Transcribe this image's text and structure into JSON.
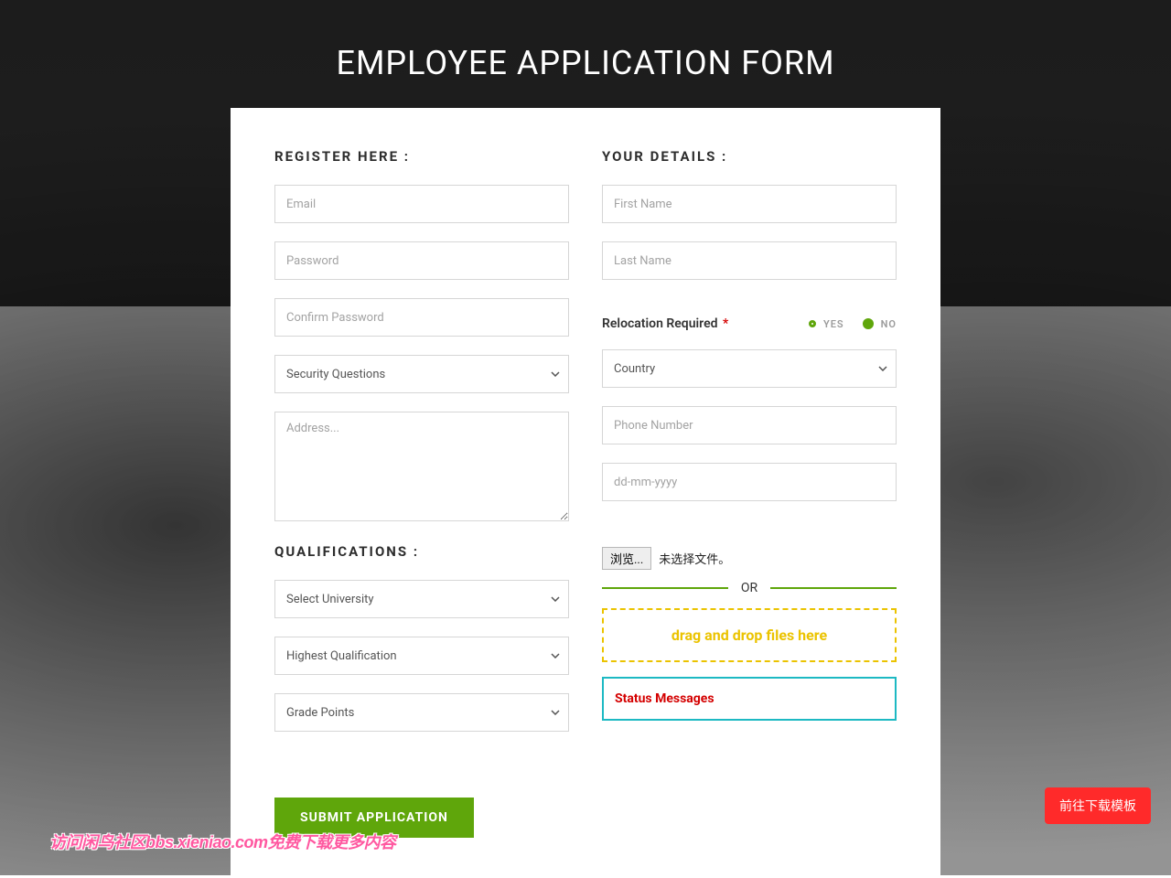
{
  "title": "EMPLOYEE APPLICATION FORM",
  "register": {
    "heading": "REGISTER HERE :",
    "email_ph": "Email",
    "password_ph": "Password",
    "confirm_ph": "Confirm Password",
    "security_select": "Security Questions",
    "address_ph": "Address..."
  },
  "qualifications": {
    "heading": "QUALIFICATIONS :",
    "university_select": "Select University",
    "highest_select": "Highest Qualification",
    "grade_select": "Grade Points"
  },
  "details": {
    "heading": "YOUR DETAILS :",
    "first_name_ph": "First Name",
    "last_name_ph": "Last Name",
    "relocation_label": "Relocation Required",
    "relocation_ast": "*",
    "relocation_yes": "YES",
    "relocation_no": "NO",
    "relocation_value": "NO",
    "country_select": "Country",
    "phone_ph": "Phone Number",
    "dob_ph": "dd-mm-yyyy",
    "browse_btn": "浏览...",
    "file_status": "未选择文件。",
    "or_label": "OR",
    "drop_label": "drag and drop files here",
    "status_label": "Status Messages"
  },
  "submit_label": "SUBMIT APPLICATION",
  "floating_btn": "前往下载模板",
  "watermark": "访问闲鸟社区bbs.xieniao.com免费下载更多内容"
}
